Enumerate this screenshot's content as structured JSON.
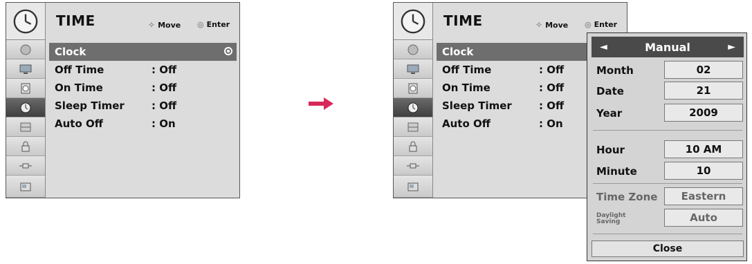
{
  "accent_color": "#d8285a",
  "left_menu": {
    "title": "TIME",
    "hint_move": "Move",
    "hint_enter": "Enter",
    "items": [
      {
        "label": "Clock",
        "value": ""
      },
      {
        "label": "Off Time",
        "value": ": Off"
      },
      {
        "label": "On Time",
        "value": ": Off"
      },
      {
        "label": "Sleep Timer",
        "value": ": Off"
      },
      {
        "label": "Auto Off",
        "value": ": On"
      }
    ]
  },
  "right_menu": {
    "title": "TIME",
    "hint_move": "Move",
    "hint_enter": "Enter",
    "items": [
      {
        "label": "Clock",
        "value": ""
      },
      {
        "label": "Off Time",
        "value": ": Off"
      },
      {
        "label": "On Time",
        "value": ": Off"
      },
      {
        "label": "Sleep Timer",
        "value": ": Off"
      },
      {
        "label": "Auto Off",
        "value": ": On"
      }
    ]
  },
  "sidebar_icons": [
    "satellite-dish-icon",
    "tv-picture-icon",
    "speaker-audio-icon",
    "clock-time-icon",
    "option-grid-icon",
    "lock-icon",
    "input-plug-icon",
    "usb-photo-icon"
  ],
  "popup": {
    "mode": "Manual",
    "fields": [
      {
        "label": "Month",
        "value": "02"
      },
      {
        "label": "Date",
        "value": "21"
      },
      {
        "label": "Year",
        "value": "2009"
      },
      {
        "label": "Hour",
        "value": "10 AM"
      },
      {
        "label": "Minute",
        "value": "10"
      },
      {
        "label": "Time Zone",
        "value": "Eastern"
      },
      {
        "label": "Daylight Saving",
        "value": "Auto"
      }
    ],
    "close_label": "Close"
  }
}
